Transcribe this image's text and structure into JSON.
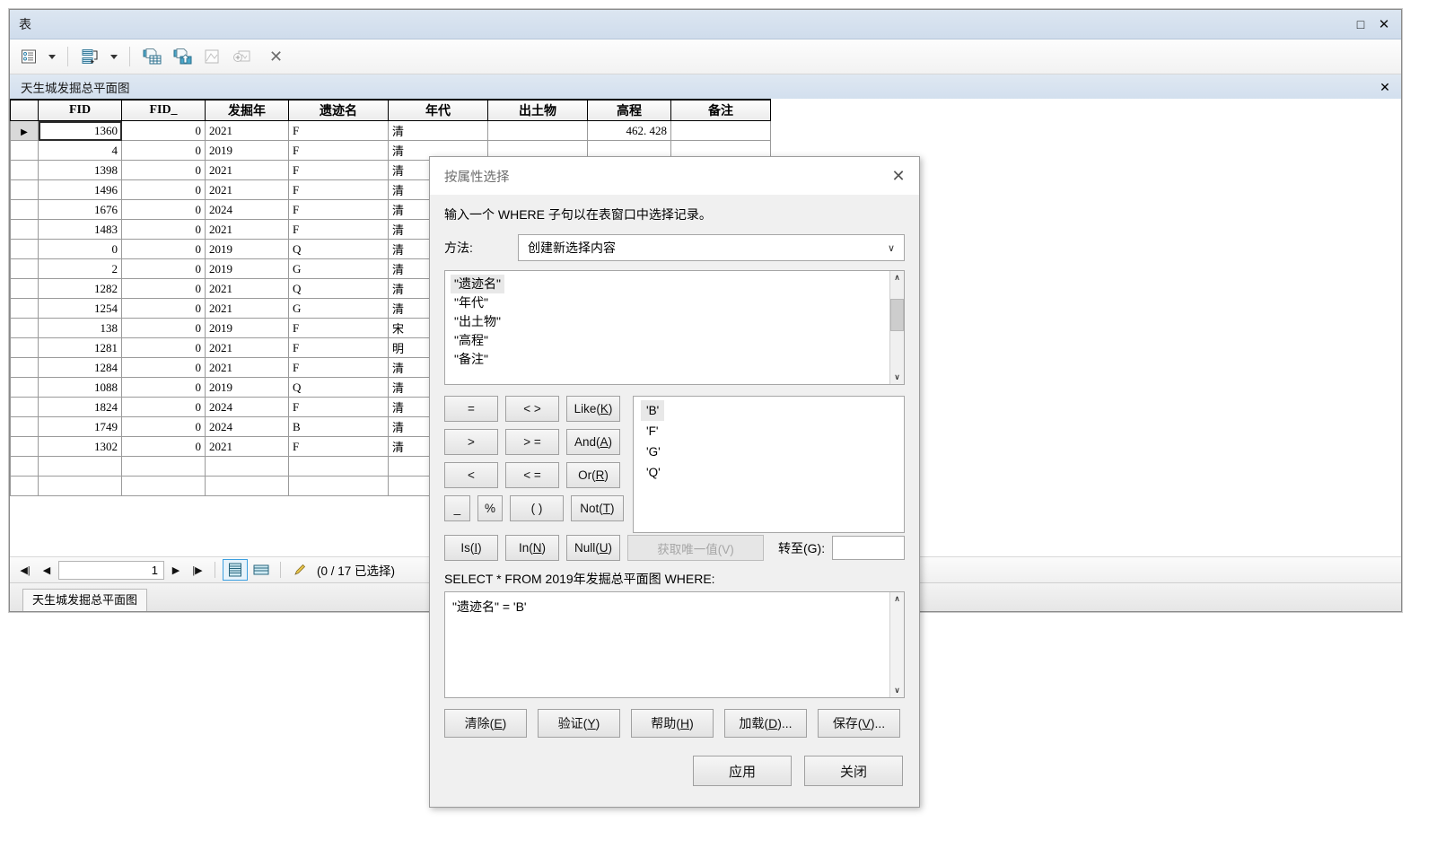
{
  "window": {
    "title": "表",
    "maximize_icon": "maximize-icon",
    "close_icon": "close-icon",
    "maximize_glyph": "□",
    "close_glyph": "✕"
  },
  "toolbar": {
    "items": [
      {
        "name": "table-options-button",
        "icon": "table-options-icon"
      },
      {
        "name": "table-options-dropdown",
        "icon": "chevron-down-icon"
      },
      {
        "name": "related-tables-button",
        "icon": "related-tables-icon"
      },
      {
        "name": "related-tables-dropdown",
        "icon": "chevron-down-icon"
      },
      {
        "name": "select-by-attributes-button",
        "icon": "select-by-attributes-icon"
      },
      {
        "name": "switch-selection-button",
        "icon": "switch-selection-icon"
      },
      {
        "name": "zoom-to-selected-button",
        "icon": "zoom-to-selected-icon"
      },
      {
        "name": "add-field-button",
        "icon": "add-field-icon"
      },
      {
        "name": "clear-selection-button",
        "icon": "clear-selection-icon",
        "glyph": "✕"
      }
    ]
  },
  "tab_strip": {
    "tab_label": "天生城发掘总平面图",
    "close_glyph": "✕"
  },
  "grid": {
    "columns": [
      "FID",
      "FID_",
      "发掘年",
      "遗迹名",
      "年代",
      "出土物",
      "高程",
      "备注"
    ],
    "rows": [
      {
        "current": true,
        "FID": "1360",
        "FID_": "0",
        "发掘年": "2021",
        "遗迹名": "F",
        "年代": "清",
        "出土物": "",
        "高程": "462. 428",
        "备注": ""
      },
      {
        "current": false,
        "FID": "4",
        "FID_": "0",
        "发掘年": "2019",
        "遗迹名": "F",
        "年代": "清",
        "出土物": "",
        "高程": "",
        "备注": ""
      },
      {
        "current": false,
        "FID": "1398",
        "FID_": "0",
        "发掘年": "2021",
        "遗迹名": "F",
        "年代": "清",
        "出土物": "",
        "高程": "",
        "备注": ""
      },
      {
        "current": false,
        "FID": "1496",
        "FID_": "0",
        "发掘年": "2021",
        "遗迹名": "F",
        "年代": "清",
        "出土物": "",
        "高程": "",
        "备注": ""
      },
      {
        "current": false,
        "FID": "1676",
        "FID_": "0",
        "发掘年": "2024",
        "遗迹名": "F",
        "年代": "清",
        "出土物": "",
        "高程": "",
        "备注": ""
      },
      {
        "current": false,
        "FID": "1483",
        "FID_": "0",
        "发掘年": "2021",
        "遗迹名": "F",
        "年代": "清",
        "出土物": "",
        "高程": "",
        "备注": ""
      },
      {
        "current": false,
        "FID": "0",
        "FID_": "0",
        "发掘年": "2019",
        "遗迹名": "Q",
        "年代": "清",
        "出土物": "",
        "高程": "",
        "备注": ""
      },
      {
        "current": false,
        "FID": "2",
        "FID_": "0",
        "发掘年": "2019",
        "遗迹名": "G",
        "年代": "清",
        "出土物": "",
        "高程": "",
        "备注": ""
      },
      {
        "current": false,
        "FID": "1282",
        "FID_": "0",
        "发掘年": "2021",
        "遗迹名": "Q",
        "年代": "清",
        "出土物": "",
        "高程": "",
        "备注": ""
      },
      {
        "current": false,
        "FID": "1254",
        "FID_": "0",
        "发掘年": "2021",
        "遗迹名": "G",
        "年代": "清",
        "出土物": "",
        "高程": "",
        "备注": ""
      },
      {
        "current": false,
        "FID": "138",
        "FID_": "0",
        "发掘年": "2019",
        "遗迹名": "F",
        "年代": "宋",
        "出土物": "",
        "高程": "",
        "备注": ""
      },
      {
        "current": false,
        "FID": "1281",
        "FID_": "0",
        "发掘年": "2021",
        "遗迹名": "F",
        "年代": "明",
        "出土物": "",
        "高程": "",
        "备注": ""
      },
      {
        "current": false,
        "FID": "1284",
        "FID_": "0",
        "发掘年": "2021",
        "遗迹名": "F",
        "年代": "清",
        "出土物": "",
        "高程": "",
        "备注": ""
      },
      {
        "current": false,
        "FID": "1088",
        "FID_": "0",
        "发掘年": "2019",
        "遗迹名": "Q",
        "年代": "清",
        "出土物": "",
        "高程": "",
        "备注": ""
      },
      {
        "current": false,
        "FID": "1824",
        "FID_": "0",
        "发掘年": "2024",
        "遗迹名": "F",
        "年代": "清",
        "出土物": "",
        "高程": "",
        "备注": ""
      },
      {
        "current": false,
        "FID": "1749",
        "FID_": "0",
        "发掘年": "2024",
        "遗迹名": "B",
        "年代": "清",
        "出土物": "",
        "高程": "",
        "备注": ""
      },
      {
        "current": false,
        "FID": "1302",
        "FID_": "0",
        "发掘年": "2021",
        "遗迹名": "F",
        "年代": "清",
        "出土物": "",
        "高程": "",
        "备注": ""
      }
    ]
  },
  "navbar": {
    "first_glyph": "◀|",
    "prev_glyph": "◀",
    "record_number": "1",
    "next_glyph": "▶",
    "last_glyph": "|▶",
    "view_all_icon": "view-all-records-icon",
    "view_selected_icon": "view-selected-records-icon",
    "edit_icon": "edit-pencil-icon",
    "selection_status": "(0 / 17 已选择)"
  },
  "bottom_tabs": {
    "tabs": [
      "天生城发掘总平面图"
    ]
  },
  "dialog": {
    "title": "按属性选择",
    "close_glyph": "✕",
    "hint": "输入一个 WHERE 子句以在表窗口中选择记录。",
    "method_label": "方法:",
    "method_value": "创建新选择内容",
    "method_arrow": "∨",
    "fields": [
      {
        "label": "\"遗迹名\"",
        "selected": true
      },
      {
        "label": "\"年代\"",
        "selected": false
      },
      {
        "label": "\"出土物\"",
        "selected": false
      },
      {
        "label": "\"高程\"",
        "selected": false
      },
      {
        "label": "\"备注\"",
        "selected": false
      }
    ],
    "field_scroll_up": "∧",
    "field_scroll_down": "∨",
    "operators": [
      [
        {
          "label": "=",
          "name": "op-equals",
          "w": "w58"
        },
        {
          "label": "< >",
          "name": "op-not-equals",
          "w": "w58"
        },
        {
          "label": "Like(K)",
          "name": "op-like",
          "w": "w58",
          "mn": "K"
        }
      ],
      [
        {
          "label": ">",
          "name": "op-greater",
          "w": "w58"
        },
        {
          "label": "> =",
          "name": "op-greater-equals",
          "w": "w58"
        },
        {
          "label": "And(A)",
          "name": "op-and",
          "w": "w58",
          "mn": "A"
        }
      ],
      [
        {
          "label": "<",
          "name": "op-less",
          "w": "w58"
        },
        {
          "label": "< =",
          "name": "op-less-equals",
          "w": "w58"
        },
        {
          "label": "Or(R)",
          "name": "op-or",
          "w": "w58",
          "mn": "R"
        }
      ]
    ],
    "op_row4": [
      {
        "label": "_",
        "name": "op-underscore",
        "w": "w27"
      },
      {
        "label": "%",
        "name": "op-percent",
        "w": "w27"
      },
      {
        "label": "( )",
        "name": "op-parens",
        "w": "w58"
      },
      {
        "label": "Not(T)",
        "name": "op-not",
        "w": "w58",
        "mn": "T"
      }
    ],
    "op_row5": [
      {
        "label": "Is(I)",
        "name": "op-is",
        "w": "w58",
        "mn": "I"
      },
      {
        "label": "In(N)",
        "name": "op-in",
        "w": "w58",
        "mn": "N"
      },
      {
        "label": "Null(U)",
        "name": "op-null",
        "w": "w58",
        "mn": "U"
      }
    ],
    "values": [
      {
        "label": "'B'",
        "selected": true
      },
      {
        "label": "'F'",
        "selected": false
      },
      {
        "label": "'G'",
        "selected": false
      },
      {
        "label": "'Q'",
        "selected": false
      }
    ],
    "unique_button": "获取唯一值(V)",
    "unique_disabled": true,
    "goto_label": "转至(G):",
    "goto_value": "",
    "sql_prefix": "SELECT * FROM 2019年发掘总平面图 WHERE:",
    "sql_text": "\"遗迹名\" = 'B'",
    "sql_scroll_up": "∧",
    "sql_scroll_down": "∨",
    "action_buttons": [
      {
        "label": "清除(E)",
        "name": "clear-button"
      },
      {
        "label": "验证(Y)",
        "name": "verify-button"
      },
      {
        "label": "帮助(H)",
        "name": "help-button"
      },
      {
        "label": "加载(D)...",
        "name": "load-button"
      },
      {
        "label": "保存(V)...",
        "name": "save-button"
      }
    ],
    "main_buttons": [
      {
        "label": "应用",
        "name": "apply-button"
      },
      {
        "label": "关闭",
        "name": "close-button"
      }
    ]
  }
}
